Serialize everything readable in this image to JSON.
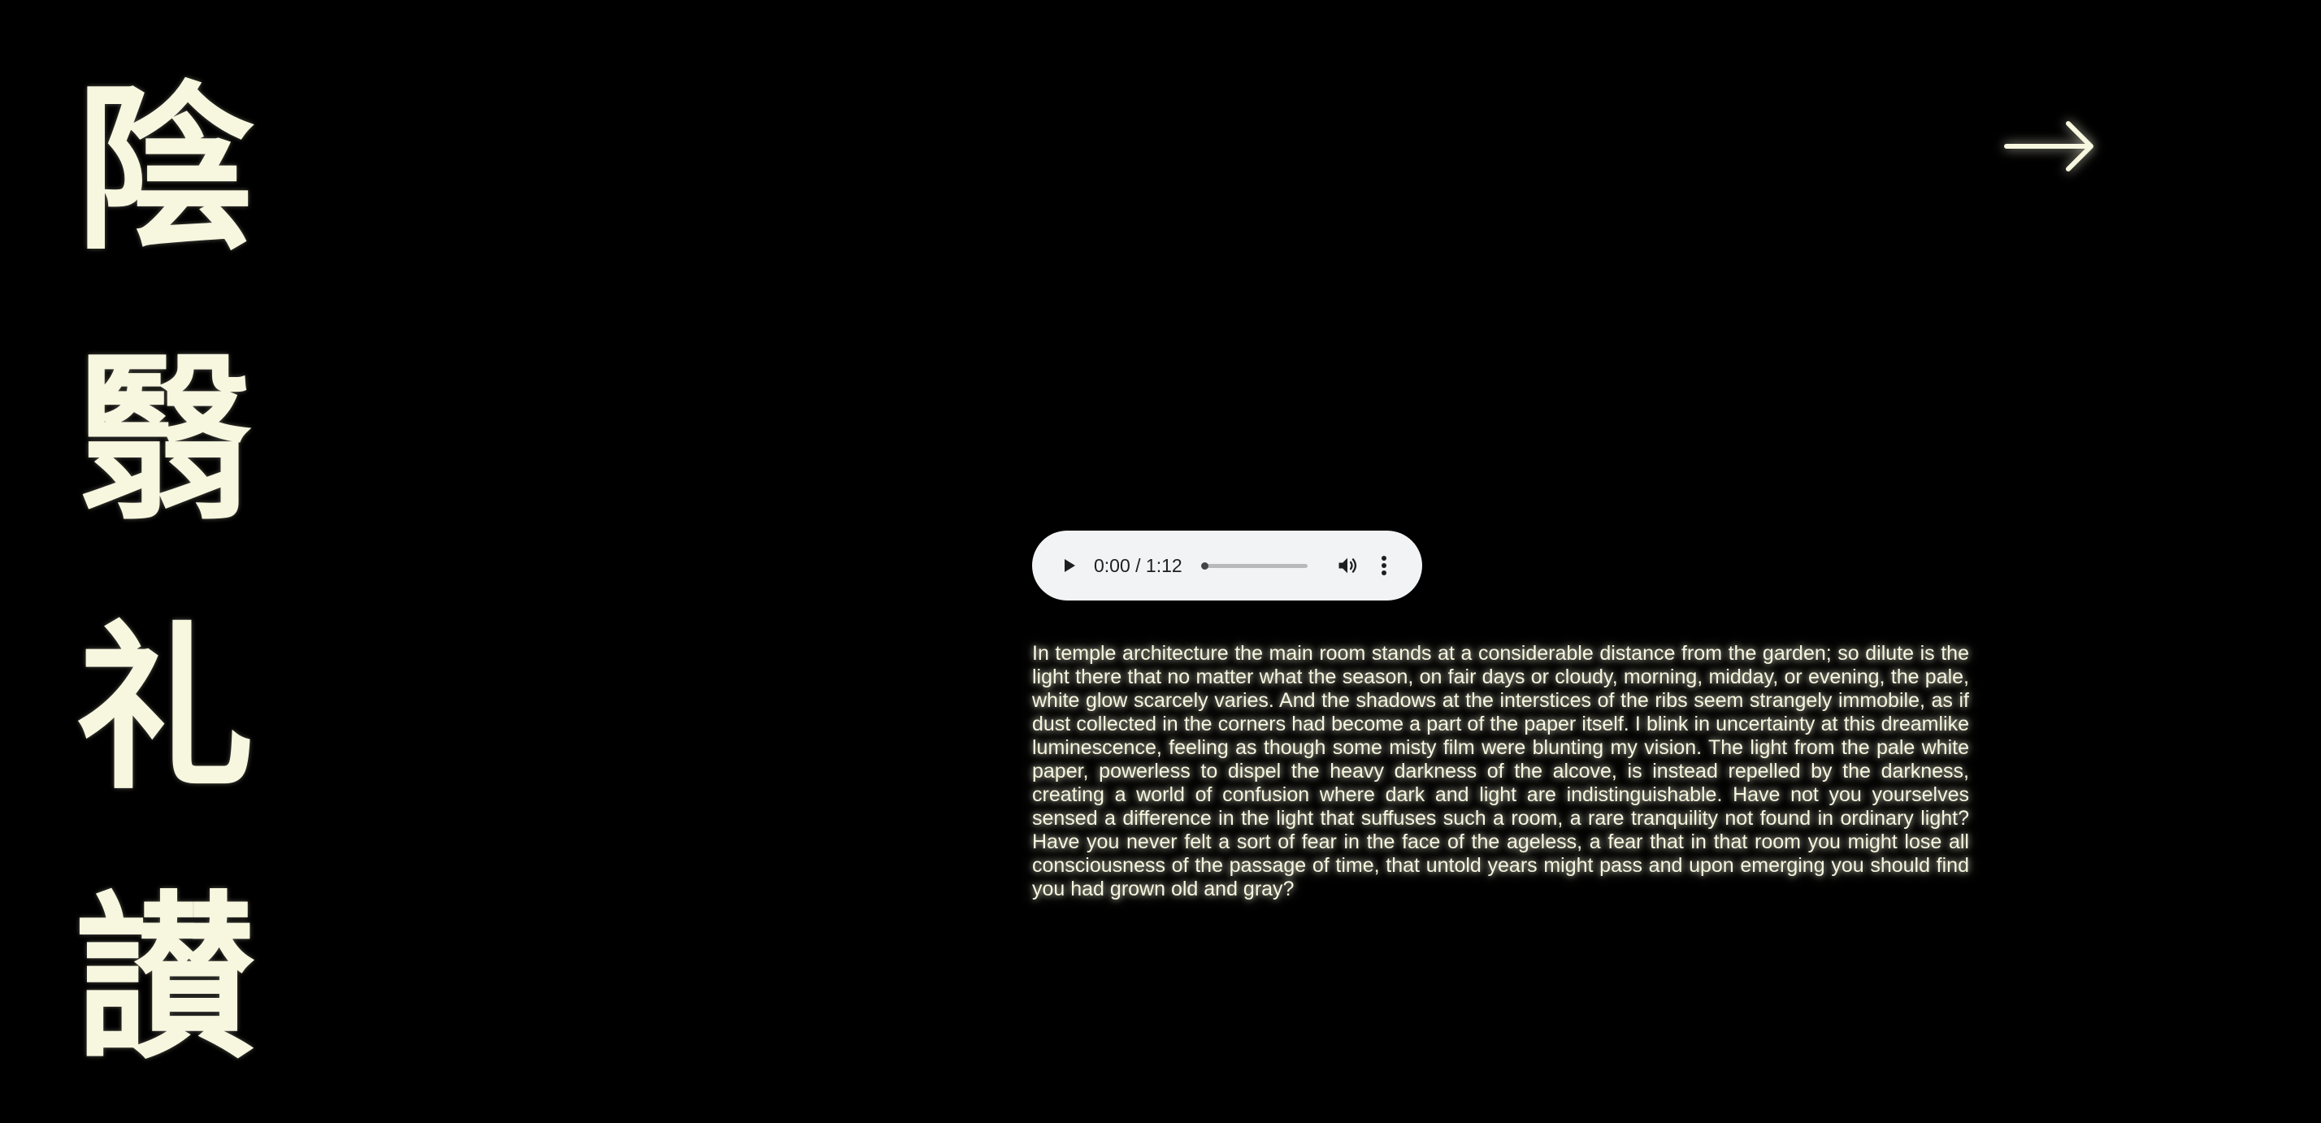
{
  "title": {
    "characters": [
      "陰",
      "翳",
      "礼",
      "讃"
    ]
  },
  "navigation": {
    "next_icon": "right-arrow-icon"
  },
  "audio": {
    "current_time": "0:00",
    "duration": "1:12",
    "time_display": "0:00 / 1:12",
    "progress": 0,
    "icons": {
      "play": "play-icon",
      "volume": "volume-icon",
      "menu": "more-vertical-icon"
    }
  },
  "essay": {
    "text": "In temple architecture the main room stands at a considerable distance from the garden; so dilute is the light there that no matter what the season, on fair days or cloudy, morning, midday, or evening, the pale, white glow scarcely varies. And the shadows at the interstices of the ribs seem strangely immobile, as if dust collected in the corners had become a part of the paper itself. I blink in uncertainty at this dreamlike luminescence, feeling as though some misty film were blunting my vision. The light from the pale white paper, powerless to dispel the heavy darkness of the alcove, is instead repelled by the darkness, creating a world of confusion where dark and light are indistinguishable. Have not you yourselves sensed a difference in the light that suffuses such a room, a rare tranquility not found in ordinary light? Have you never felt a sort of fear in the face of the ageless, a fear that in that room you might lose all consciousness of the passage of time, that untold years might pass and upon emerging you should find you had grown old and gray?"
  },
  "colors": {
    "background": "#000000",
    "text": "#f7f6df",
    "player_background": "#f1f3f4"
  }
}
